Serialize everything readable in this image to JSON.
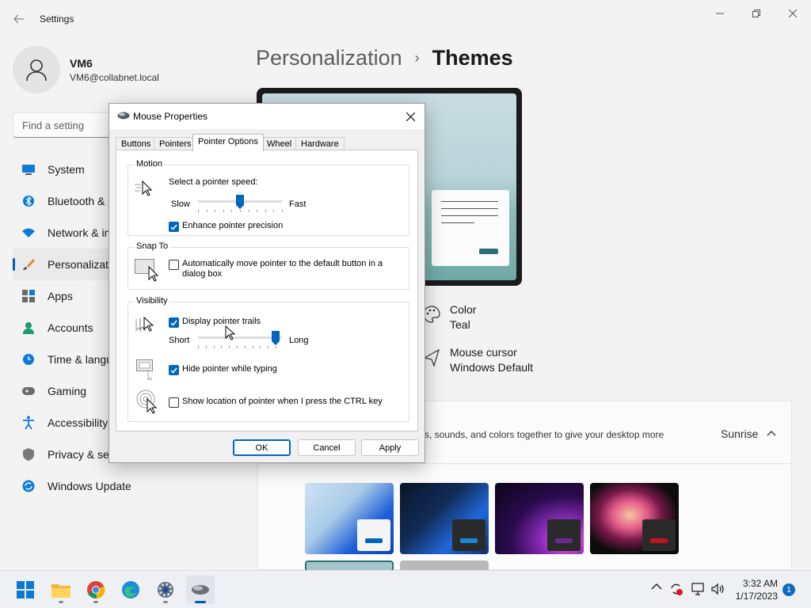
{
  "settings": {
    "app_title": "Settings",
    "user": {
      "name": "VM6",
      "email": "VM6@collabnet.local"
    },
    "search_placeholder": "Find a setting",
    "nav": [
      {
        "label": "System",
        "icon": "system-icon"
      },
      {
        "label": "Bluetooth &",
        "icon": "bluetooth-icon"
      },
      {
        "label": "Network & in",
        "icon": "network-icon"
      },
      {
        "label": "Personalizati",
        "icon": "brush-icon",
        "selected": true
      },
      {
        "label": "Apps",
        "icon": "apps-icon"
      },
      {
        "label": "Accounts",
        "icon": "accounts-icon"
      },
      {
        "label": "Time & langu",
        "icon": "clock-icon"
      },
      {
        "label": "Gaming",
        "icon": "gamepad-icon"
      },
      {
        "label": "Accessibility",
        "icon": "accessibility-icon"
      },
      {
        "label": "Privacy & se",
        "icon": "shield-icon"
      },
      {
        "label": "Windows Update",
        "icon": "update-icon"
      }
    ],
    "breadcrumb": {
      "parent": "Personalization",
      "separator": "›",
      "current": "Themes"
    },
    "properties": [
      {
        "name": "Color",
        "value": "Teal",
        "icon": "palette-icon"
      },
      {
        "name": "Mouse cursor",
        "value": "Windows Default",
        "icon": "cursor-icon"
      }
    ],
    "current_theme": {
      "description": "s, sounds, and colors together to give your desktop more",
      "value": "Sunrise"
    },
    "accent_color": "#005fb8"
  },
  "dialog": {
    "title": "Mouse Properties",
    "tabs": [
      "Buttons",
      "Pointers",
      "Pointer Options",
      "Wheel",
      "Hardware"
    ],
    "active_tab": "Pointer Options",
    "motion": {
      "group": "Motion",
      "speed_label": "Select a pointer speed:",
      "slow": "Slow",
      "fast": "Fast",
      "speed_level": 0.5,
      "enhance_precision": {
        "label": "Enhance pointer precision",
        "checked": true
      }
    },
    "snap_to": {
      "group": "Snap To",
      "auto_move": {
        "label": "Automatically move pointer to the default button in a dialog box",
        "checked": false
      }
    },
    "visibility": {
      "group": "Visibility",
      "trails": {
        "label": "Display pointer trails",
        "checked": true
      },
      "short": "Short",
      "long": "Long",
      "trail_level": 1.0,
      "hide_typing": {
        "label": "Hide pointer while typing",
        "checked": true
      },
      "show_ctrl": {
        "label": "Show location of pointer when I press the CTRL key",
        "checked": false
      }
    },
    "buttons": {
      "ok": "OK",
      "cancel": "Cancel",
      "apply": "Apply"
    }
  },
  "taskbar": {
    "apps": [
      "start-icon",
      "file-explorer-icon",
      "chrome-icon",
      "edge-icon",
      "settings-icon",
      "mouse-icon"
    ],
    "time": "3:32 AM",
    "date": "1/17/2023",
    "notifications": "1"
  }
}
